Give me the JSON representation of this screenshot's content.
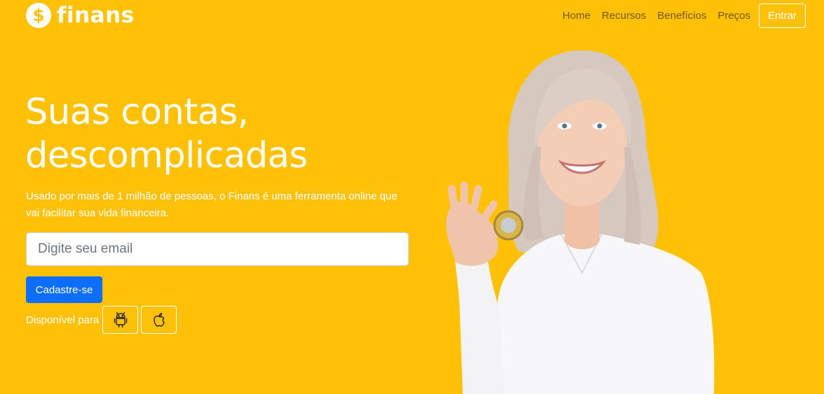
{
  "brand": {
    "icon": "dollar-circle-icon",
    "symbol": "$",
    "name": "finans"
  },
  "nav": {
    "items": [
      {
        "label": "Home"
      },
      {
        "label": "Recursos"
      },
      {
        "label": "Benefícios"
      },
      {
        "label": "Preços"
      }
    ],
    "login_label": "Entrar"
  },
  "hero": {
    "title_line1": "Suas contas,",
    "title_line2": "descomplicadas",
    "subtitle": "Usado por mais de 1 milhão de pessoas, o Finans é uma ferramenta online que vai facilitar sua vida financeira.",
    "email_placeholder": "Digite seu email",
    "signup_label": "Cadastre-se",
    "available_label": "Disponível para",
    "platforms": [
      "android-icon",
      "apple-icon"
    ]
  },
  "colors": {
    "background": "#ffc107",
    "primary_button": "#0d6efd",
    "text_light": "#ffffff"
  }
}
